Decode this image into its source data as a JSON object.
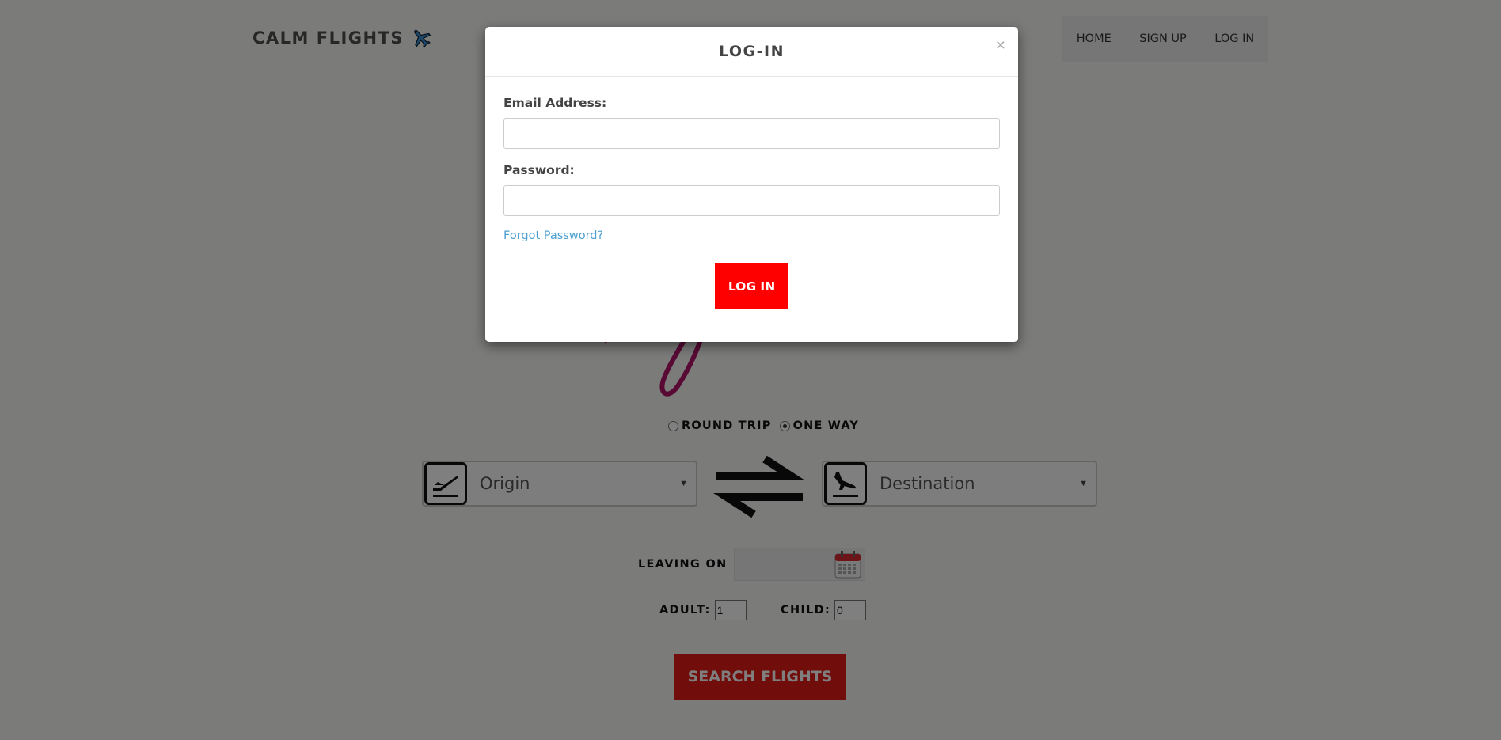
{
  "header": {
    "brand": "CALM FLIGHTS",
    "nav": [
      "HOME",
      "SIGN UP",
      "LOG IN"
    ]
  },
  "trip_type": {
    "options": [
      "ROUND TRIP",
      "ONE WAY"
    ],
    "selected": "ONE WAY"
  },
  "search": {
    "origin_placeholder": "Origin",
    "destination_placeholder": "Destination",
    "leaving_label": "LEAVING ON",
    "leaving_value": "",
    "adult_label": "ADULT:",
    "adult_value": "1",
    "child_label": "CHILD:",
    "child_value": "0",
    "search_button": "SEARCH FLIGHTS"
  },
  "modal": {
    "title": "LOG-IN",
    "close_label": "×",
    "email_label": "Email Address:",
    "email_value": "",
    "password_label": "Password:",
    "password_value": "",
    "forgot_link": "Forgot Password?",
    "submit_label": "LOG IN"
  },
  "colors": {
    "accent_red": "#ff0000",
    "search_red": "#e31b14",
    "link_blue": "#4a9ed0",
    "overlay": "rgba(0,0,0,0.5)"
  },
  "icons": [
    "airplane-icon",
    "departure-icon",
    "arrival-icon",
    "swap-arrows-icon",
    "calendar-icon"
  ]
}
